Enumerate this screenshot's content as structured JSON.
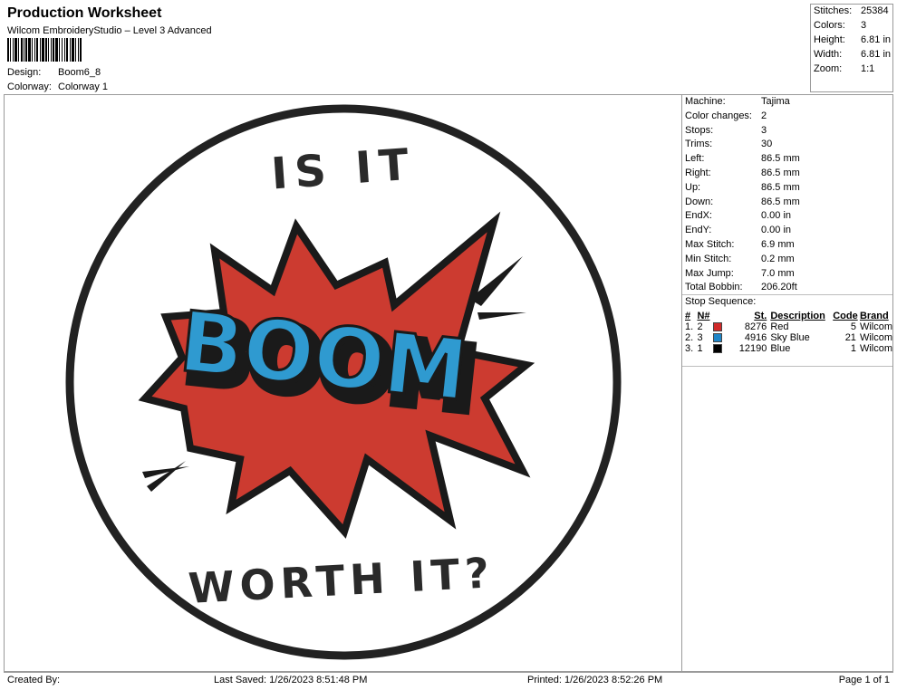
{
  "header": {
    "title": "Production Worksheet",
    "software": "Wilcom EmbroideryStudio – Level 3 Advanced",
    "design_label": "Design:",
    "design_value": "Boom6_8",
    "colorway_label": "Colorway:",
    "colorway_value": "Colorway 1"
  },
  "stats": [
    {
      "label": "Stitches:",
      "value": "25384"
    },
    {
      "label": "Colors:",
      "value": "3"
    },
    {
      "label": "Height:",
      "value": "6.81 in"
    },
    {
      "label": "Width:",
      "value": "6.81 in"
    },
    {
      "label": "Zoom:",
      "value": "1:1"
    }
  ],
  "machine_info": [
    {
      "label": "Machine:",
      "value": "Tajima"
    },
    {
      "label": "Color changes:",
      "value": "2"
    },
    {
      "label": "Stops:",
      "value": "3"
    },
    {
      "label": "Trims:",
      "value": "30"
    },
    {
      "label": "Left:",
      "value": "86.5 mm"
    },
    {
      "label": "Right:",
      "value": "86.5 mm"
    },
    {
      "label": "Up:",
      "value": "86.5 mm"
    },
    {
      "label": "Down:",
      "value": "86.5 mm"
    },
    {
      "label": "EndX:",
      "value": "0.00 in"
    },
    {
      "label": "EndY:",
      "value": "0.00 in"
    },
    {
      "label": "Max Stitch:",
      "value": "6.9 mm"
    },
    {
      "label": "Min Stitch:",
      "value": "0.2 mm"
    },
    {
      "label": "Max Jump:",
      "value": "7.0 mm"
    },
    {
      "label": "Total Bobbin:",
      "value": "206.20ft"
    }
  ],
  "stop_sequence": {
    "title": "Stop Sequence:",
    "headers": {
      "num": "#",
      "n": "N#",
      "st": "St.",
      "desc": "Description",
      "code": "Code",
      "brand": "Brand"
    },
    "rows": [
      {
        "num": "1.",
        "n": "2",
        "color": "#d12a2a",
        "st": "8276",
        "desc": "Red",
        "code": "5",
        "brand": "Wilcom"
      },
      {
        "num": "2.",
        "n": "3",
        "color": "#1f86c8",
        "st": "4916",
        "desc": "Sky Blue",
        "code": "21",
        "brand": "Wilcom"
      },
      {
        "num": "3.",
        "n": "1",
        "color": "#000000",
        "st": "12190",
        "desc": "Blue",
        "code": "1",
        "brand": "Wilcom"
      }
    ]
  },
  "design_art": {
    "top_text": "IS IT",
    "center_text": "BOOM",
    "bottom_text": "WORTH IT?",
    "burst_color": "#cc3b30",
    "boom_color": "#2f9ad0"
  },
  "footer": {
    "created_by": "Created By:",
    "last_saved": "Last Saved: 1/26/2023 8:51:48 PM",
    "printed": "Printed: 1/26/2023 8:52:26 PM",
    "page": "Page 1 of 1"
  }
}
